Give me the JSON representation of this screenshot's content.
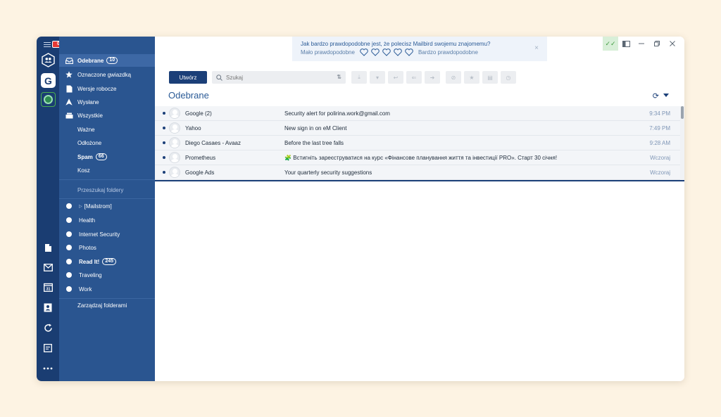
{
  "account_bar": {
    "menu_badge": "0",
    "accounts": [
      {
        "name": "unified-inbox",
        "icon": "people-icon"
      },
      {
        "name": "google",
        "icon": "google-g-icon",
        "letter": "G"
      },
      {
        "name": "other",
        "icon": "other-account-icon"
      }
    ],
    "apps": [
      "file-icon",
      "mail-icon",
      "calendar-icon",
      "contacts-icon",
      "refresh-app-icon",
      "notes-icon",
      "more-icon"
    ],
    "calendar_day": "31"
  },
  "folders": {
    "items": [
      {
        "label": "Odebrane",
        "count": "10",
        "icon": "inbox-icon",
        "bold": true,
        "selected": true
      },
      {
        "label": "Oznaczone gwiazdką",
        "icon": "star-icon"
      },
      {
        "label": "Wersje robocze",
        "icon": "draft-icon"
      },
      {
        "label": "Wysłane",
        "icon": "sent-icon"
      },
      {
        "label": "Wszystkie",
        "icon": "all-mail-icon"
      },
      {
        "label": "Ważne"
      },
      {
        "label": "Odłożone"
      },
      {
        "label": "Spam",
        "count": "66",
        "bold": true
      },
      {
        "label": "Kosz"
      }
    ],
    "search_label": "Przeszukaj foldery",
    "labels": [
      {
        "label": "[Mailstrom]",
        "caret": true
      },
      {
        "label": "Health"
      },
      {
        "label": "Internet Security"
      },
      {
        "label": "Photos"
      },
      {
        "label": "Read It!",
        "count": "245",
        "bold": true
      },
      {
        "label": "Traveling"
      },
      {
        "label": "Work"
      }
    ],
    "manage_label": "Zarządzaj folderami"
  },
  "survey": {
    "question": "Jak bardzo prawdopodobne jest, że polecisz Mailbird swojemu znajomemu?",
    "low_label": "Mało prawdopodobne",
    "high_label": "Bardzo prawdopodobne",
    "hearts": 5,
    "close": "×"
  },
  "toolbar": {
    "compose_label": "Utwórz",
    "search_placeholder": "Szukaj",
    "sort_glyph": "⇅",
    "tools": [
      "download-icon",
      "archive-icon",
      "reply-icon",
      "reply-all-icon",
      "forward-icon",
      "spam-icon",
      "star-icon",
      "move-icon",
      "snooze-icon"
    ]
  },
  "view_title": "Odebrane",
  "messages": [
    {
      "sender": "Google  (2)",
      "subject": "Security alert for polirina.work@gmail.com",
      "time": "9:34 PM",
      "unread": true
    },
    {
      "sender": "Yahoo",
      "subject": "New sign in on eM Client",
      "time": "7:49 PM",
      "unread": true
    },
    {
      "sender": "Diego Casaes - Avaaz",
      "subject": "Before the last tree falls",
      "time": "9:28 AM",
      "unread": true
    },
    {
      "sender": "Prometheus",
      "subject": "Встигніть зареєструватися на курс «Фінансове планування життя та інвестиції PRO». Старт 30 січня!",
      "time": "Wczoraj",
      "unread": true
    },
    {
      "sender": "Google Ads",
      "subject": "Your quarterly security suggestions",
      "time": "Wczoraj",
      "unread": true
    }
  ],
  "colors": {
    "background": "#fdf3e3",
    "account_bar": "#1a3d72",
    "folder_pane": "#2a5590",
    "accent": "#1b3f78",
    "time_text": "#7f96b6"
  }
}
